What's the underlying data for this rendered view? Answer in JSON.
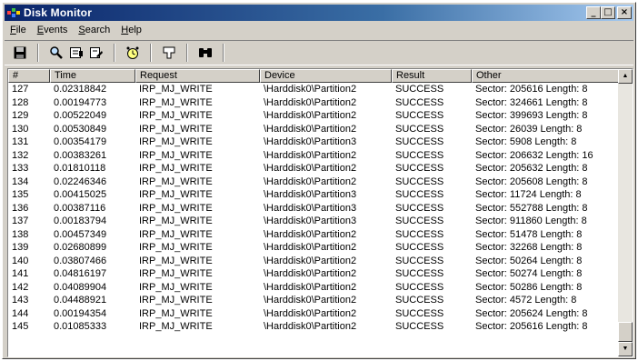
{
  "window": {
    "title": "Disk Monitor",
    "caption_buttons": {
      "minimize": "_",
      "maximize": "□",
      "close": "×"
    }
  },
  "menu": [
    {
      "underline": "F",
      "rest": "ile"
    },
    {
      "underline": "E",
      "rest": "vents"
    },
    {
      "underline": "S",
      "rest": "earch"
    },
    {
      "underline": "H",
      "rest": "elp"
    }
  ],
  "toolbar": {
    "icons": [
      "save-icon",
      "find-icon",
      "capture-icon",
      "autoscroll-icon",
      "clock-icon",
      "filter-icon",
      "search-binoculars-icon"
    ]
  },
  "table": {
    "columns": [
      "#",
      "Time",
      "Request",
      "Device",
      "Result",
      "Other"
    ],
    "rows": [
      [
        "127",
        "0.02318842",
        "IRP_MJ_WRITE",
        "\\Harddisk0\\Partition2",
        "SUCCESS",
        "Sector: 205616  Length: 8"
      ],
      [
        "128",
        "0.00194773",
        "IRP_MJ_WRITE",
        "\\Harddisk0\\Partition2",
        "SUCCESS",
        "Sector: 324661  Length: 8"
      ],
      [
        "129",
        "0.00522049",
        "IRP_MJ_WRITE",
        "\\Harddisk0\\Partition2",
        "SUCCESS",
        "Sector: 399693  Length: 8"
      ],
      [
        "130",
        "0.00530849",
        "IRP_MJ_WRITE",
        "\\Harddisk0\\Partition2",
        "SUCCESS",
        "Sector: 26039  Length: 8"
      ],
      [
        "131",
        "0.00354179",
        "IRP_MJ_WRITE",
        "\\Harddisk0\\Partition3",
        "SUCCESS",
        "Sector: 5908  Length: 8"
      ],
      [
        "132",
        "0.00383261",
        "IRP_MJ_WRITE",
        "\\Harddisk0\\Partition2",
        "SUCCESS",
        "Sector: 206632  Length: 16"
      ],
      [
        "133",
        "0.01810118",
        "IRP_MJ_WRITE",
        "\\Harddisk0\\Partition2",
        "SUCCESS",
        "Sector: 205632  Length: 8"
      ],
      [
        "134",
        "0.02246346",
        "IRP_MJ_WRITE",
        "\\Harddisk0\\Partition2",
        "SUCCESS",
        "Sector: 205608  Length: 8"
      ],
      [
        "135",
        "0.00415025",
        "IRP_MJ_WRITE",
        "\\Harddisk0\\Partition3",
        "SUCCESS",
        "Sector: 11724  Length: 8"
      ],
      [
        "136",
        "0.00387116",
        "IRP_MJ_WRITE",
        "\\Harddisk0\\Partition3",
        "SUCCESS",
        "Sector: 552788  Length: 8"
      ],
      [
        "137",
        "0.00183794",
        "IRP_MJ_WRITE",
        "\\Harddisk0\\Partition3",
        "SUCCESS",
        "Sector: 911860  Length: 8"
      ],
      [
        "138",
        "0.00457349",
        "IRP_MJ_WRITE",
        "\\Harddisk0\\Partition2",
        "SUCCESS",
        "Sector: 51478  Length: 8"
      ],
      [
        "139",
        "0.02680899",
        "IRP_MJ_WRITE",
        "\\Harddisk0\\Partition2",
        "SUCCESS",
        "Sector: 32268  Length: 8"
      ],
      [
        "140",
        "0.03807466",
        "IRP_MJ_WRITE",
        "\\Harddisk0\\Partition2",
        "SUCCESS",
        "Sector: 50264  Length: 8"
      ],
      [
        "141",
        "0.04816197",
        "IRP_MJ_WRITE",
        "\\Harddisk0\\Partition2",
        "SUCCESS",
        "Sector: 50274  Length: 8"
      ],
      [
        "142",
        "0.04089904",
        "IRP_MJ_WRITE",
        "\\Harddisk0\\Partition2",
        "SUCCESS",
        "Sector: 50286  Length: 8"
      ],
      [
        "143",
        "0.04488921",
        "IRP_MJ_WRITE",
        "\\Harddisk0\\Partition2",
        "SUCCESS",
        "Sector: 4572  Length: 8"
      ],
      [
        "144",
        "0.00194354",
        "IRP_MJ_WRITE",
        "\\Harddisk0\\Partition2",
        "SUCCESS",
        "Sector: 205624  Length: 8"
      ],
      [
        "145",
        "0.01085333",
        "IRP_MJ_WRITE",
        "\\Harddisk0\\Partition2",
        "SUCCESS",
        "Sector: 205616  Length: 8"
      ]
    ]
  },
  "scrollbar": {
    "up_arrow": "▲",
    "down_arrow": "▼"
  },
  "colors": {
    "title_start": "#0a246a",
    "title_end": "#a6caf0",
    "face": "#d4d0c8"
  }
}
